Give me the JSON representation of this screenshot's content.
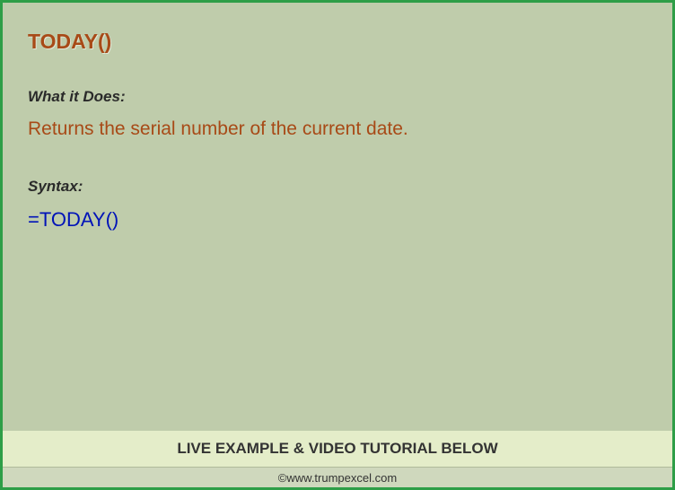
{
  "title": "TODAY()",
  "sections": {
    "what_label": "What it Does:",
    "what_description": "Returns the serial number of the current date.",
    "syntax_label": "Syntax:",
    "syntax_code": "=TODAY()"
  },
  "banner": "LIVE EXAMPLE & VIDEO TUTORIAL BELOW",
  "footer": "©www.trumpexcel.com"
}
